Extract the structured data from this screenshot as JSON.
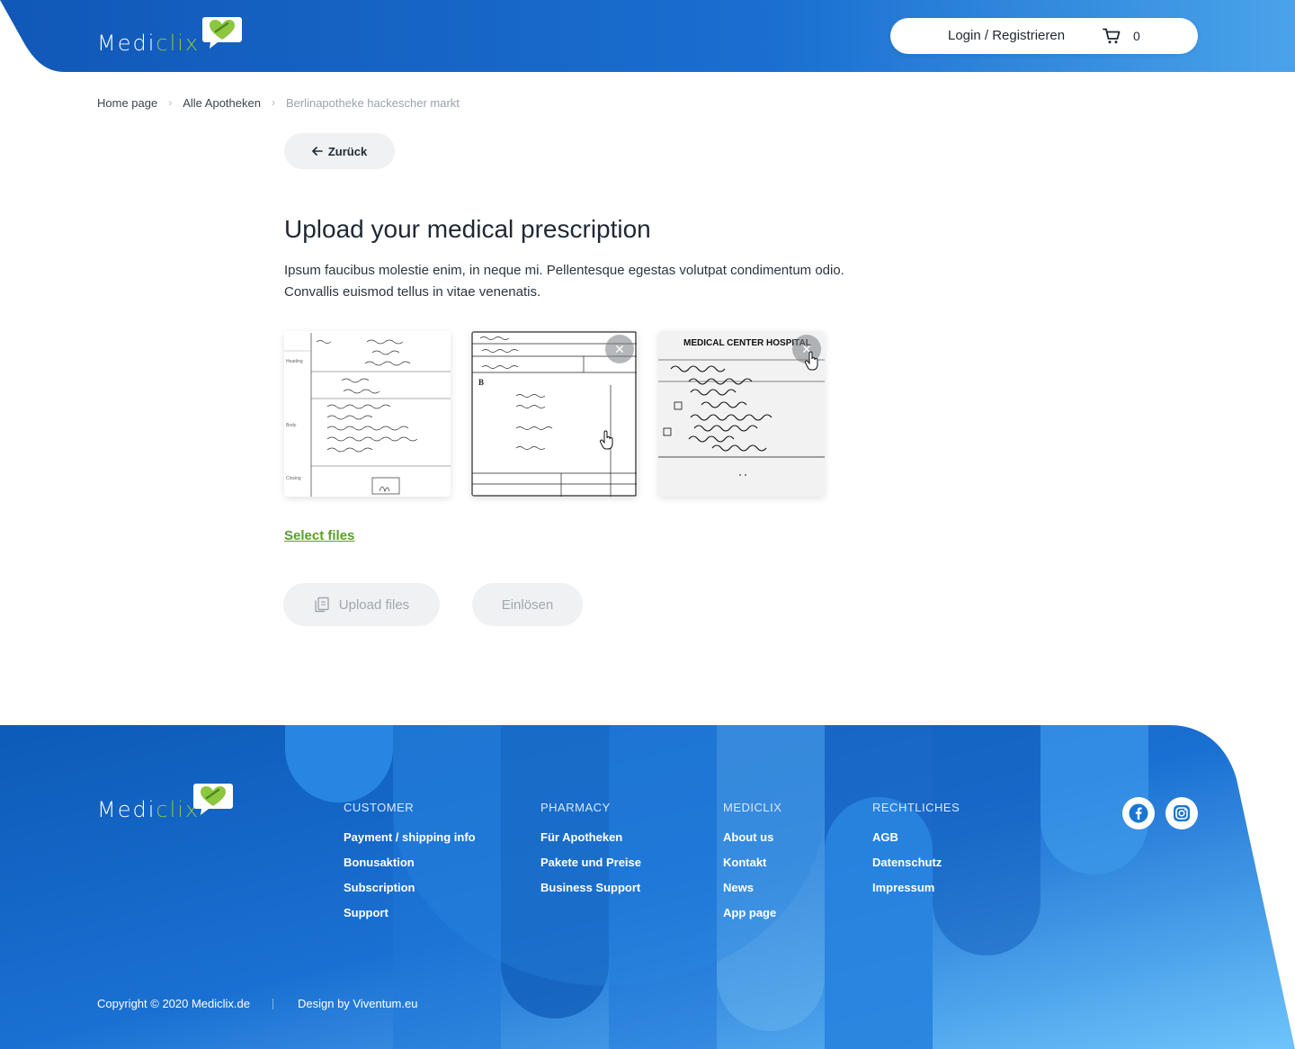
{
  "brand": {
    "logo_part1": "Medi",
    "logo_part2": "clix",
    "primary_color": "#1565c0",
    "accent_color": "#8dc63f"
  },
  "header": {
    "login_label": "Login / Registrieren",
    "cart_count": "0",
    "cart_icon": "cart-icon"
  },
  "breadcrumb": {
    "items": [
      "Home page",
      "Alle Apotheken",
      "Berlinapotheke hackescher markt"
    ]
  },
  "back_button": {
    "label": "Zurück",
    "icon": "arrow-left-icon"
  },
  "main": {
    "title": "Upload your medical prescription",
    "description_line1": "Ipsum faucibus molestie enim, in neque mi. Pellentesque egestas volutpat condimentum odio.",
    "description_line2": "Convallis euismod tellus in vitae venenatis.",
    "thumbnails": [
      {
        "name": "prescription-1",
        "has_remove": false
      },
      {
        "name": "prescription-2",
        "has_remove": true
      },
      {
        "name": "prescription-3",
        "has_remove": true,
        "header_text": "MEDICAL CENTER HOSPITAL"
      }
    ],
    "select_files_label": "Select files",
    "upload_button_label": "Upload files",
    "redeem_button_label": "Einlösen"
  },
  "footer": {
    "columns": [
      {
        "title": "CUSTOMER",
        "links": [
          "Payment / shipping info",
          "Bonusaktion",
          "Subscription",
          "Support"
        ]
      },
      {
        "title": "PHARMACY",
        "links": [
          "Für Apotheken",
          "Pakete und Preise",
          "Business Support"
        ]
      },
      {
        "title": "MEDICLIX",
        "links": [
          "About us",
          "Kontakt",
          "News",
          "App page"
        ]
      },
      {
        "title": "RECHTLICHES",
        "links": [
          "AGB",
          "Datenschutz",
          "Impressum"
        ]
      }
    ],
    "social": [
      "facebook-icon",
      "instagram-icon"
    ],
    "copyright": "Copyright © 2020 Mediclix.de",
    "separator": "|",
    "design_by": "Design by Viventum.eu"
  }
}
